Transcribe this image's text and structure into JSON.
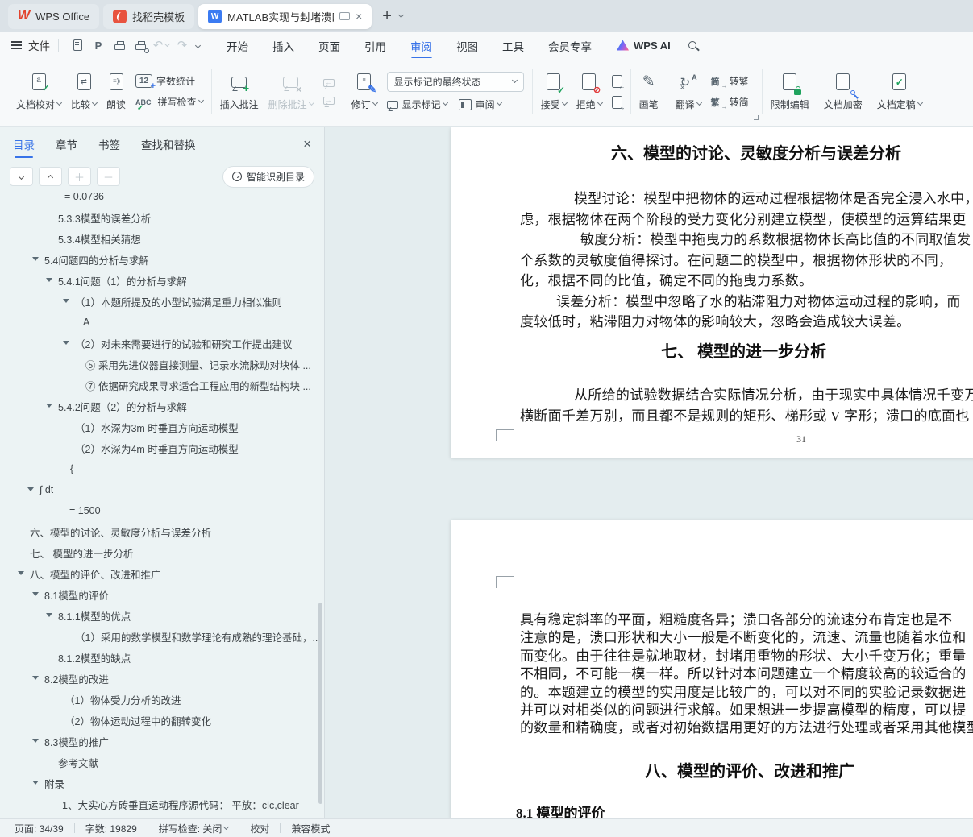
{
  "titlebar": {
    "tabs": [
      {
        "label": "WPS Office"
      },
      {
        "label": "找稻壳模板"
      },
      {
        "label": "MATLAB实现与封堵溃口有关"
      }
    ]
  },
  "menubar": {
    "file": "文件",
    "items": [
      "开始",
      "插入",
      "页面",
      "引用",
      "审阅",
      "视图",
      "工具",
      "会员专享"
    ],
    "active": "审阅",
    "wps_ai": "WPS AI"
  },
  "ribbon": {
    "doc_proof": "文档校对",
    "compare": "比较",
    "read_aloud": "朗读",
    "word_count": "字数统计",
    "word_count_num": "12",
    "spell_abc": "ABC",
    "spell_check": "拼写检查",
    "insert_comment": "插入批注",
    "delete_comment": "删除批注",
    "track_changes": "修订",
    "markup_state": "显示标记的最终状态",
    "show_markup": "显示标记",
    "review_pane": "审阅",
    "accept": "接受",
    "reject": "拒绝",
    "pen": "画笔",
    "translate": "翻译",
    "trad_char": "简",
    "to_trad": "转繁",
    "simp_char": "繁",
    "to_simp": "转简",
    "restrict_edit": "限制编辑",
    "encrypt": "文档加密",
    "finalize": "文档定稿"
  },
  "sidebar": {
    "tabs": [
      "目录",
      "章节",
      "书签",
      "查找和替换"
    ],
    "active_tab": "目录",
    "smart_toc": "智能识别目录",
    "outline": [
      {
        "text": "= 0.0736",
        "indent": 80,
        "arrow": false
      },
      {
        "text": "5.3.3模型的误差分析",
        "indent": 72,
        "arrow": false
      },
      {
        "text": "5.3.4模型相关猜想",
        "indent": 72,
        "arrow": false
      },
      {
        "text": "5.4问题四的分析与求解",
        "indent": 55,
        "arrow": true
      },
      {
        "text": "5.4.1问题（1）的分析与求解",
        "indent": 72,
        "arrow": true
      },
      {
        "text": "（1）本题所提及的小型试验满足重力相似准则",
        "indent": 93,
        "arrow": true
      },
      {
        "text": "A",
        "indent": 103,
        "arrow": false
      },
      {
        "text": "（2）对未来需要进行的试验和研究工作提出建议",
        "indent": 93,
        "arrow": true
      },
      {
        "text": "⑤ 采用先进仪器直接测量、记录水流脉动对块体 ...",
        "indent": 106,
        "arrow": false
      },
      {
        "text": "⑦ 依据研究成果寻求适合工程应用的新型结构块 ...",
        "indent": 106,
        "arrow": false
      },
      {
        "text": "5.4.2问题（2）的分析与求解",
        "indent": 72,
        "arrow": true
      },
      {
        "text": "（1）水深为3m 时垂直方向运动模型",
        "indent": 93,
        "arrow": false
      },
      {
        "text": "（2）水深为4m 时垂直方向运动模型",
        "indent": 93,
        "arrow": false
      },
      {
        "text": "{",
        "indent": 87,
        "arrow": false
      },
      {
        "text": "∫ dt",
        "indent": 49,
        "arrow": true
      },
      {
        "text": "= 1500",
        "indent": 86,
        "arrow": false
      },
      {
        "text": "六、模型的讨论、灵敏度分析与误差分析",
        "indent": 37,
        "arrow": false
      },
      {
        "text": "七、 模型的进一步分析",
        "indent": 37,
        "arrow": false
      },
      {
        "text": "八、模型的评价、改进和推广",
        "indent": 37,
        "arrow": true
      },
      {
        "text": "8.1模型的评价",
        "indent": 55,
        "arrow": true
      },
      {
        "text": "8.1.1模型的优点",
        "indent": 72,
        "arrow": true
      },
      {
        "text": "（1）采用的数学模型和数学理论有成熟的理论基础，...",
        "indent": 93,
        "arrow": false
      },
      {
        "text": "8.1.2模型的缺点",
        "indent": 72,
        "arrow": false
      },
      {
        "text": "8.2模型的改进",
        "indent": 55,
        "arrow": true
      },
      {
        "text": "（1）物体受力分析的改进",
        "indent": 80,
        "arrow": false
      },
      {
        "text": "（2）物体运动过程中的翻转变化",
        "indent": 80,
        "arrow": false
      },
      {
        "text": "8.3模型的推广",
        "indent": 55,
        "arrow": true
      },
      {
        "text": "参考文献",
        "indent": 72,
        "arrow": false
      },
      {
        "text": "附录",
        "indent": 55,
        "arrow": true
      },
      {
        "text": "1、大实心方砖垂直运动程序源代码： 平放：clc,clear",
        "indent": 77,
        "arrow": false
      }
    ]
  },
  "document": {
    "page1": {
      "heading1": "六、模型的讨论、灵敏度分析与误差分析",
      "para1": [
        "模型讨论：模型中把物体的运动过程根据物体是否完全浸入水中，",
        "虑，根据物体在两个阶段的受力变化分别建立模型，使模型的运算结果更",
        "敏度分析：模型中拖曳力的系数根据物体长高比值的不同取值发",
        "个系数的灵敏度值得探讨。在问题二的模型中，根据物体形状的不同，",
        "化，根据不同的比值，确定不同的拖曳力系数。",
        "误差分析：模型中忽略了水的粘滞阻力对物体运动过程的影响，而",
        "度较低时，粘滞阻力对物体的影响较大，忽略会造成较大误差。"
      ],
      "heading2": "七、 模型的进一步分析",
      "para2": [
        "从所给的试验数据结合实际情况分析，由于现实中具体情况千变万",
        "横断面千差万别，而且都不是规则的矩形、梯形或 V 字形；溃口的底面也"
      ],
      "page_number": "31"
    },
    "page2": {
      "lines": [
        "具有稳定斜率的平面，粗糙度各异；溃口各部分的流速分布肯定也是不",
        "注意的是，溃口形状和大小一般是不断变化的，流速、流量也随着水位和",
        "而变化。由于往往是就地取材，封堵用重物的形状、大小千变万化；重量",
        "不相同，不可能一模一样。所以针对本问题建立一个精度较高的较适合的",
        "的。本题建立的模型的实用度是比较广的，可以对不同的实验记录数据进",
        "并可以对相类似的问题进行求解。如果想进一步提高模型的精度，可以提",
        "的数量和精确度，或者对初始数据用更好的方法进行处理或者采用其他模型"
      ],
      "heading": "八、模型的评价、改进和推广",
      "subheading": "8.1 模型的评价"
    }
  },
  "statusbar": {
    "page": "页面: 34/39",
    "words": "字数: 19829",
    "spell": "拼写检查: 关闭",
    "proof": "校对",
    "mode": "兼容模式"
  }
}
